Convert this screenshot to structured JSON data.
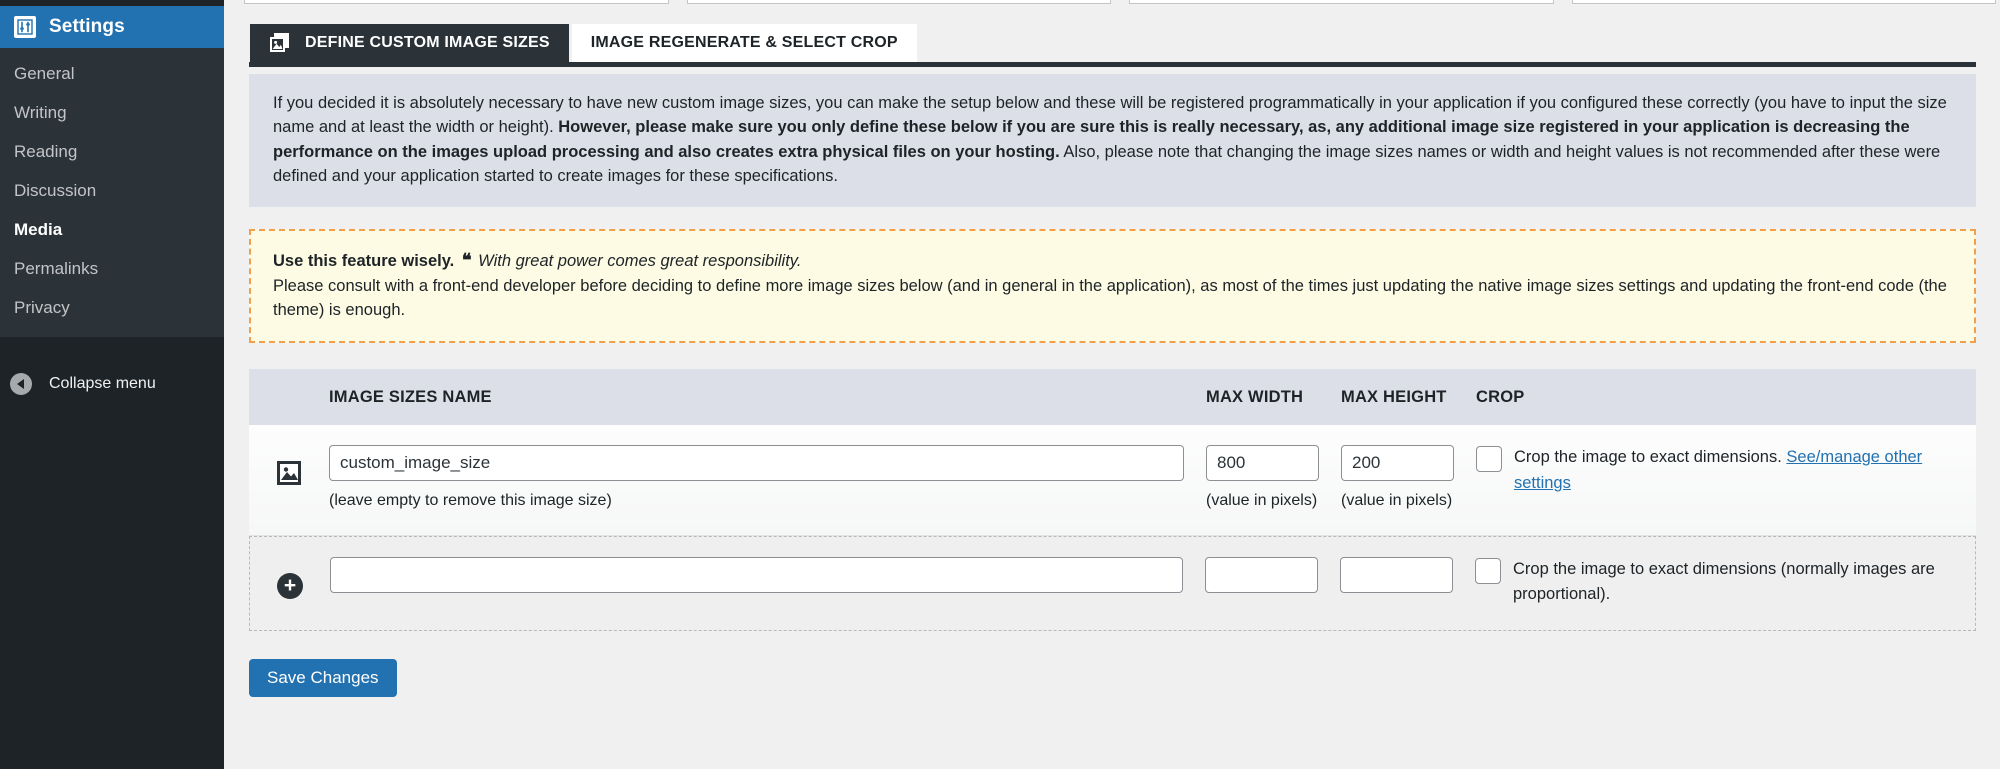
{
  "sidebar": {
    "menu_title": "Settings",
    "menu_icon": "settings-sliders-icon",
    "items": [
      {
        "label": "General",
        "current": false
      },
      {
        "label": "Writing",
        "current": false
      },
      {
        "label": "Reading",
        "current": false
      },
      {
        "label": "Discussion",
        "current": false
      },
      {
        "label": "Media",
        "current": true
      },
      {
        "label": "Permalinks",
        "current": false
      },
      {
        "label": "Privacy",
        "current": false
      }
    ],
    "collapse_label": "Collapse menu",
    "collapse_icon": "chevron-left-circle-icon",
    "colors": {
      "header": "#2271b1",
      "submenu": "#2c3338",
      "base": "#1d2327"
    }
  },
  "tabs": [
    {
      "label": "DEFINE CUSTOM IMAGE SIZES",
      "active": true,
      "icon": "images-stack-icon"
    },
    {
      "label": "IMAGE REGENERATE & SELECT CROP",
      "active": false,
      "icon": ""
    }
  ],
  "intro": {
    "part1": "If you decided it is absolutely necessary to have new custom image sizes, you can make the setup below and these will be registered programmatically in your application if you configured these correctly (you have to input the size name and at least the width or height). ",
    "bold": "However, please make sure you only define these below if you are sure this is really necessary, as, any additional image size registered in your application is decreasing the performance on the images upload processing and also creates extra physical files on your hosting.",
    "part2": " Also, please note that changing the image sizes names or width and height values is not recommended after these were defined and your application started to create images for these specifications."
  },
  "warning": {
    "lead": "Use this feature wisely.",
    "quote_icon": "double-quote-icon",
    "quote": "With great power comes great responsibility.",
    "body": "Please consult with a front-end developer before deciding to define more image sizes below (and in general in the application), as most of the times just updating the native image sizes settings and updating the front-end code (the theme) is enough.",
    "border_color": "#f0a04b",
    "background": "#fdfbe4"
  },
  "table": {
    "headers": {
      "name": "IMAGE SIZES NAME",
      "max_width": "MAX WIDTH",
      "max_height": "MAX HEIGHT",
      "crop": "CROP"
    },
    "rows": [
      {
        "icon": "image-placeholder-icon",
        "name_value": "custom_image_size",
        "name_placeholder": "",
        "name_hint": "(leave empty to remove this image size)",
        "width_value": "800",
        "width_hint": "(value in pixels)",
        "height_value": "200",
        "height_hint": "(value in pixels)",
        "crop_checked": false,
        "crop_text": "Crop the image to exact dimensions.",
        "crop_link": "See/manage other settings"
      },
      {
        "icon": "plus-circle-icon",
        "name_value": "",
        "name_placeholder": "",
        "name_hint": "",
        "width_value": "",
        "width_hint": "",
        "height_value": "",
        "height_hint": "",
        "crop_checked": false,
        "crop_text": "Crop the image to exact dimensions (normally images are proportional).",
        "crop_link": ""
      }
    ]
  },
  "actions": {
    "save_label": "Save Changes",
    "save_color": "#2271b1"
  }
}
